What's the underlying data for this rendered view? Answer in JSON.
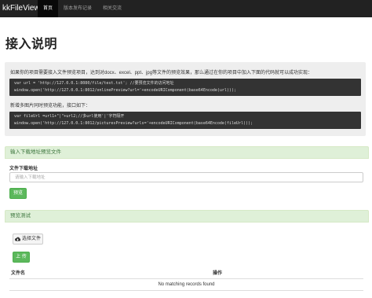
{
  "nav": {
    "brand": "kkFileView",
    "items": [
      {
        "label": "首页",
        "active": true
      },
      {
        "label": "版本发布记录",
        "active": false
      },
      {
        "label": "相关交流",
        "active": false
      }
    ]
  },
  "page_title": "接入说明",
  "intro": {
    "text1": "如果你的项目需要接入文件预览项目，达到对docx、excel、ppt、jpg等文件的预览效果，那么通过在你的项目中加入下面的代码就可以成功实现：",
    "code1_line1": "var url = 'http://127.0.0.1:8080/file/test.txt'; //要预览文件的访问地址",
    "code1_line2": "window.open('http://127.0.0.1:8012/onlinePreview?url='+encodeURIComponent(base64Encode(url)));",
    "text2": "新增多图片同时预览功能，接口如下：",
    "code2_line1": "var fileUrl =url1+\"|\"+url2;//多url使用'|'字符隔开",
    "code2_line2": "window.open('http://127.0.0.1:8012/picturesPreview?urls='+encodeURIComponent(base64Encode(fileUrl)));"
  },
  "url_panel": {
    "heading": "输入下载地址预览文件",
    "field_label": "文件下载地址",
    "placeholder": "请输入下载地址",
    "button": "预览"
  },
  "test_panel": {
    "heading": "预览测试",
    "choose_button": "选择文件",
    "upload_button": "上 传",
    "columns": [
      "文件名",
      "操作"
    ],
    "empty_message": "No matching records found"
  },
  "colors": {
    "navbar": "#222222",
    "success": "#5cb85c",
    "panel_heading": "#dff0d8",
    "code_bg": "#333333"
  }
}
